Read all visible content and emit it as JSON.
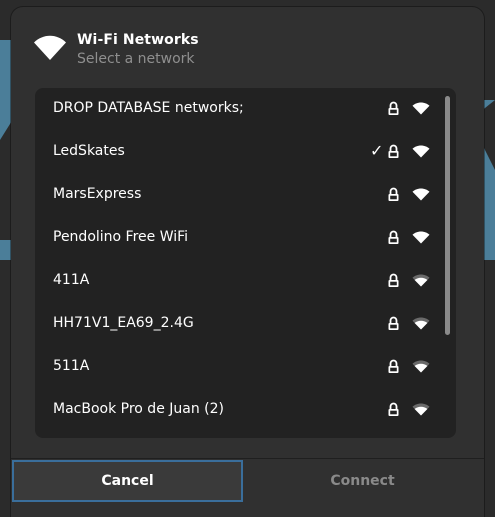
{
  "dialog": {
    "title": "Wi-Fi Networks",
    "subtitle": "Select a network",
    "icon": "wifi-icon"
  },
  "networks": [
    {
      "name": "DROP DATABASE networks;",
      "connected": false,
      "secured": true,
      "signal": 4
    },
    {
      "name": "LedSkates",
      "connected": true,
      "secured": true,
      "signal": 4
    },
    {
      "name": "MarsExpress",
      "connected": false,
      "secured": true,
      "signal": 4
    },
    {
      "name": "Pendolino Free WiFi",
      "connected": false,
      "secured": true,
      "signal": 4
    },
    {
      "name": "411A",
      "connected": false,
      "secured": true,
      "signal": 3
    },
    {
      "name": "HH71V1_EA69_2.4G",
      "connected": false,
      "secured": true,
      "signal": 3
    },
    {
      "name": "511A",
      "connected": false,
      "secured": true,
      "signal": 3
    },
    {
      "name": "MacBook Pro de Juan (2)",
      "connected": false,
      "secured": true,
      "signal": 3
    }
  ],
  "connected_mark": "✓",
  "buttons": {
    "cancel": "Cancel",
    "connect": "Connect"
  },
  "colors": {
    "accent": "#3a6e9b",
    "dialog_bg": "#303030",
    "list_bg": "#222222",
    "subtitle": "#8f8f8f",
    "disabled_text": "#8a8a8a"
  }
}
